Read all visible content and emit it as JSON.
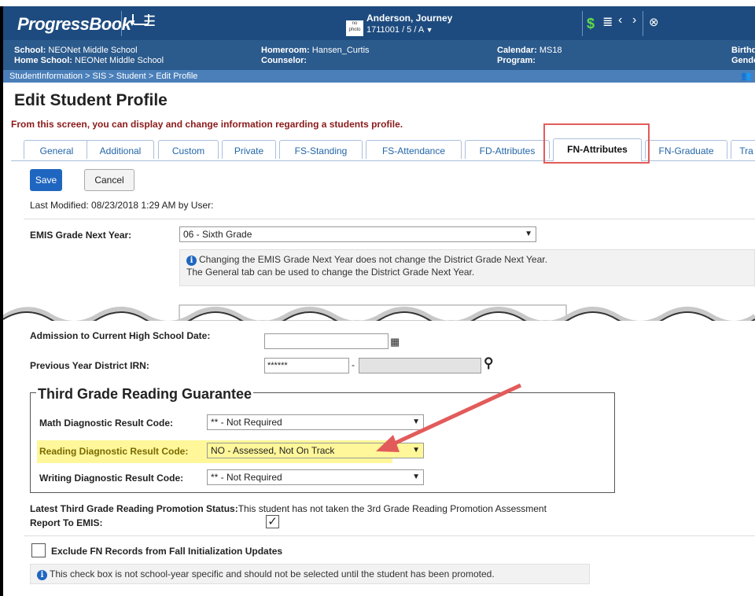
{
  "header": {
    "logo": "ProgressBook",
    "student_name": "Anderson, Journey",
    "student_id_line": "1711001  / 5 / A",
    "school_label": "School:",
    "school": "NEONet Middle School",
    "home_school_label": "Home School:",
    "home_school": "NEONet Middle School",
    "homeroom_label": "Homeroom:",
    "homeroom": "Hansen_Curtis",
    "counselor_label": "Counselor:",
    "counselor": "",
    "calendar_label": "Calendar:",
    "calendar": "MS18",
    "program_label": "Program:",
    "program": "",
    "birth_label": "Birthd",
    "gender_label": "Gende"
  },
  "breadcrumb": "StudentInformation > SIS > Student > Edit Profile",
  "page_title": "Edit Student Profile",
  "intro": "From this screen, you can display and change information regarding a students profile.",
  "tabs": [
    "General",
    "Additional",
    "Custom",
    "Private",
    "FS-Standing",
    "FS-Attendance",
    "FD-Attributes",
    "FN-Attributes",
    "FN-Graduate",
    "Tra"
  ],
  "active_tab": "FN-Attributes",
  "buttons": {
    "save": "Save",
    "cancel": "Cancel"
  },
  "last_modified": "Last Modified:  08/23/2018 1:29 AM  by User:",
  "emis_grade": {
    "label": "EMIS Grade Next Year:",
    "value": "06 - Sixth Grade",
    "note_line1": "Changing the EMIS Grade Next Year does not change the District Grade Next Year.",
    "note_line2": "The General tab can be used to change the District Grade Next Year."
  },
  "admission": {
    "label": "Admission to Current High School Date:",
    "value": ""
  },
  "prev_irn": {
    "label": "Previous Year District IRN:",
    "value": "******",
    "dash": "-"
  },
  "third_grade": {
    "title": "Third Grade Reading Guarantee",
    "math_label": "Math Diagnostic Result Code:",
    "math_value": "** - Not Required",
    "reading_label": "Reading Diagnostic Result Code:",
    "reading_value": "NO - Assessed, Not On Track",
    "writing_label": "Writing Diagnostic Result Code:",
    "writing_value": "** - Not Required"
  },
  "promotion_status": {
    "label": "Latest Third Grade Reading Promotion Status:",
    "value": "This student has not taken the 3rd Grade Reading Promotion Assessment"
  },
  "report_to_emis": {
    "label": "Report To EMIS:",
    "checked": true
  },
  "exclude_fn": {
    "label": "Exclude FN Records from Fall Initialization Updates",
    "checked": false,
    "note": "This check box is not school-year specific and should not be selected until the student has been promoted."
  },
  "colors": {
    "header": "#2b5a8c",
    "accent": "#1f66c0",
    "highlight": "#fff79a",
    "callout": "#e25b5b"
  }
}
